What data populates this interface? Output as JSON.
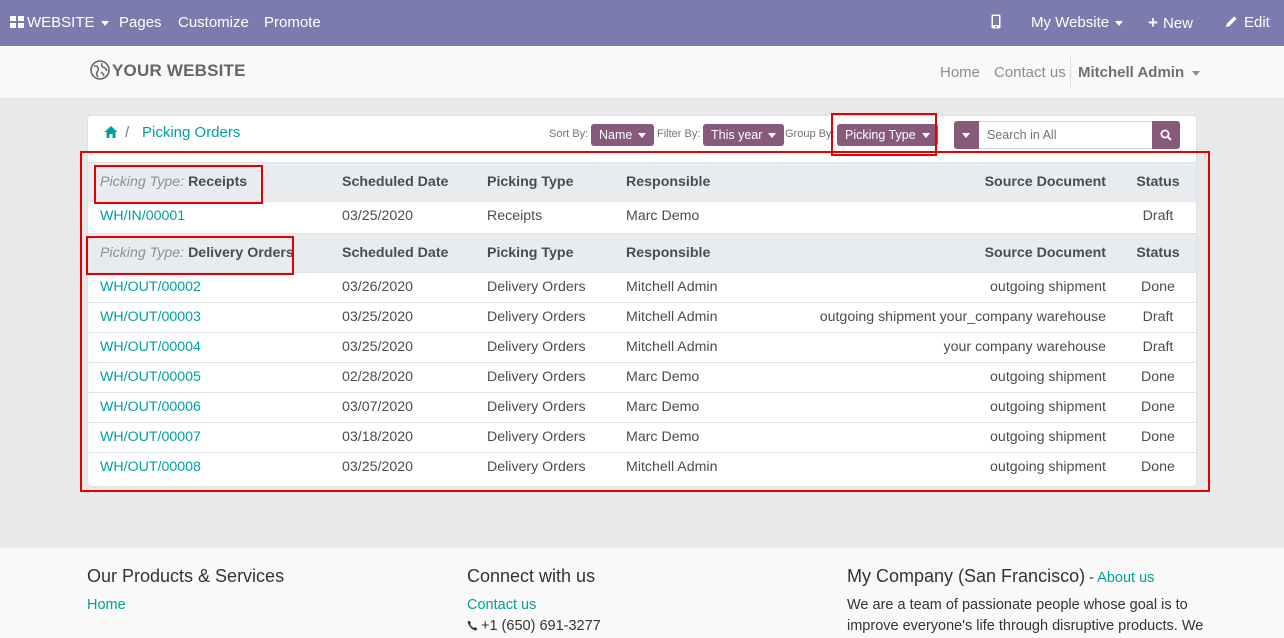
{
  "topbar": {
    "website_label": "WEBSITE",
    "pages": "Pages",
    "customize": "Customize",
    "promote": "Promote",
    "my_website": "My Website",
    "new_label": "New",
    "edit_label": "Edit"
  },
  "header": {
    "logo_text": "YOUR WEBSITE",
    "nav_home": "Home",
    "nav_contact": "Contact us",
    "user_name": "Mitchell Admin"
  },
  "breadcrumb": {
    "separator": "/",
    "current": "Picking Orders"
  },
  "controls": {
    "sort_label": "Sort By:",
    "sort_value": "Name",
    "filter_label": "Filter By:",
    "filter_value": "This year",
    "group_label": "Group By:",
    "group_value": "Picking Type",
    "search_placeholder": "Search in All"
  },
  "table": {
    "columns": [
      "Scheduled Date",
      "Picking Type",
      "Responsible",
      "Source Document",
      "Status"
    ],
    "groups": [
      {
        "label": "Picking Type:",
        "name": "Receipts",
        "rows": [
          {
            "ref": "WH/IN/00001",
            "date": "03/25/2020",
            "type": "Receipts",
            "responsible": "Marc Demo",
            "source": "",
            "status": "Draft"
          }
        ]
      },
      {
        "label": "Picking Type:",
        "name": "Delivery Orders",
        "rows": [
          {
            "ref": "WH/OUT/00002",
            "date": "03/26/2020",
            "type": "Delivery Orders",
            "responsible": "Mitchell Admin",
            "source": "outgoing shipment",
            "status": "Done"
          },
          {
            "ref": "WH/OUT/00003",
            "date": "03/25/2020",
            "type": "Delivery Orders",
            "responsible": "Mitchell Admin",
            "source": "outgoing shipment your_company warehouse",
            "status": "Draft"
          },
          {
            "ref": "WH/OUT/00004",
            "date": "03/25/2020",
            "type": "Delivery Orders",
            "responsible": "Mitchell Admin",
            "source": "your company warehouse",
            "status": "Draft"
          },
          {
            "ref": "WH/OUT/00005",
            "date": "02/28/2020",
            "type": "Delivery Orders",
            "responsible": "Marc Demo",
            "source": "outgoing shipment",
            "status": "Done"
          },
          {
            "ref": "WH/OUT/00006",
            "date": "03/07/2020",
            "type": "Delivery Orders",
            "responsible": "Marc Demo",
            "source": "outgoing shipment",
            "status": "Done"
          },
          {
            "ref": "WH/OUT/00007",
            "date": "03/18/2020",
            "type": "Delivery Orders",
            "responsible": "Marc Demo",
            "source": "outgoing shipment",
            "status": "Done"
          },
          {
            "ref": "WH/OUT/00008",
            "date": "03/25/2020",
            "type": "Delivery Orders",
            "responsible": "Mitchell Admin",
            "source": "outgoing shipment",
            "status": "Done"
          }
        ]
      }
    ]
  },
  "footer": {
    "col1_title": "Our Products & Services",
    "col1_link": "Home",
    "col2_title": "Connect with us",
    "col2_link": "Contact us",
    "col2_phone": "+1 (650) 691-3277",
    "col3_title": "My Company (San Francisco)",
    "col3_dash": " - ",
    "col3_link": "About us",
    "col3_line1": "We are a team of passionate people whose goal is to",
    "col3_line2": "improve everyone's life through disruptive products. We"
  },
  "colors": {
    "topbar": "#7c7bad",
    "accent": "#00a09d",
    "pill": "#875a7b",
    "annotation": "#e30000"
  }
}
